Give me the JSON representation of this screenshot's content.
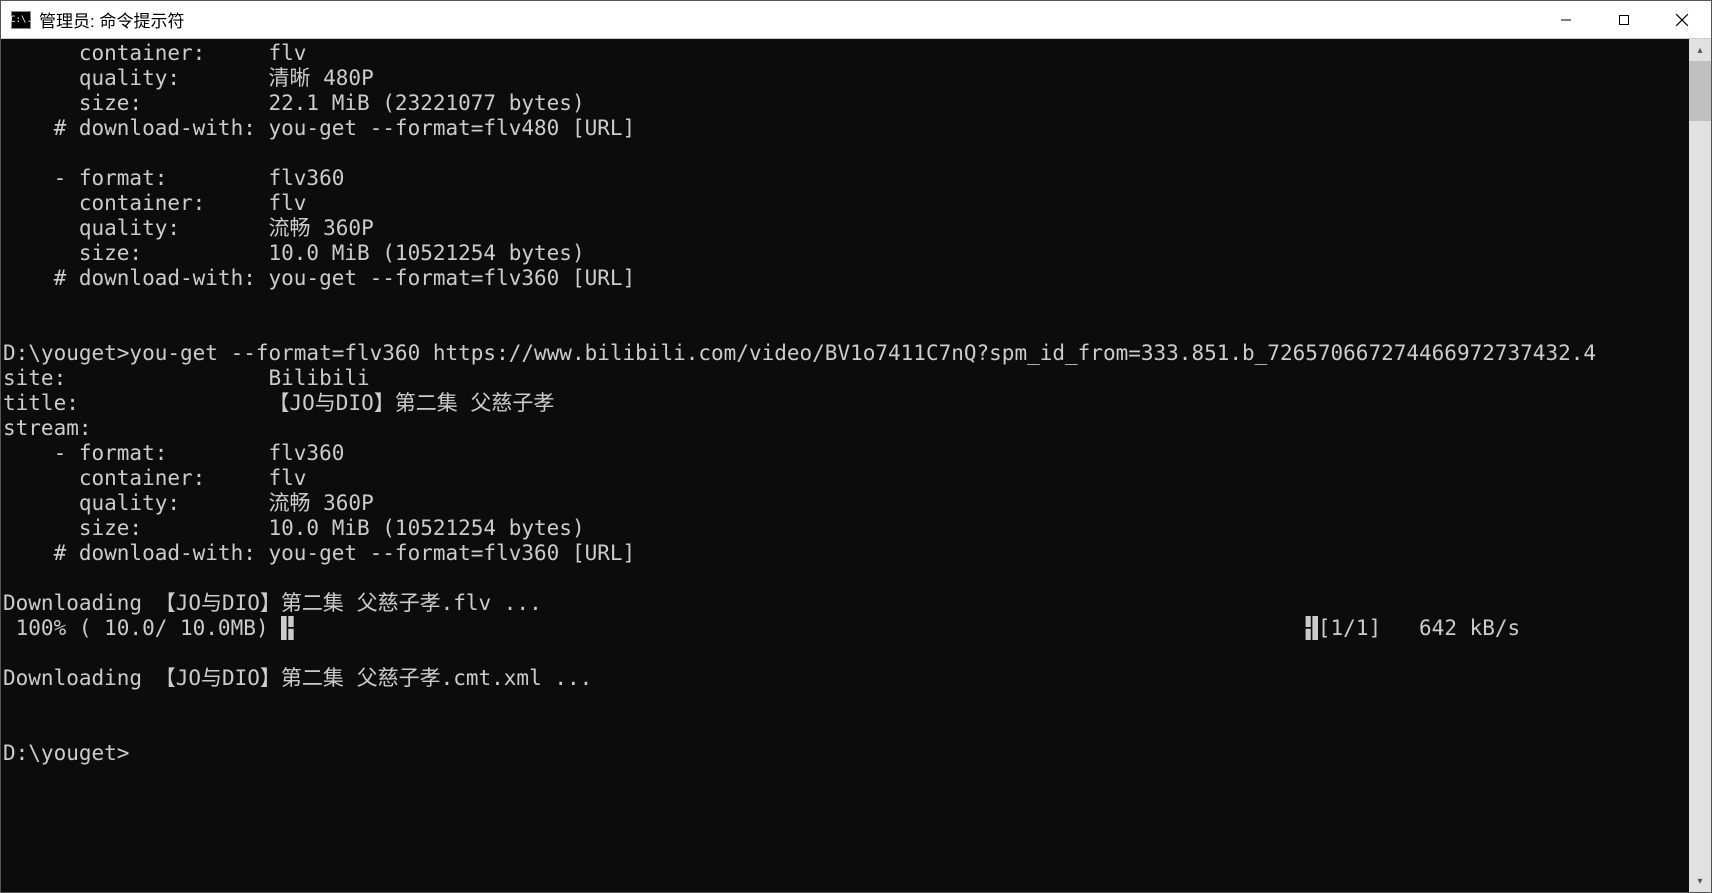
{
  "window": {
    "title": "管理员: 命令提示符",
    "icon_text": "C:\\."
  },
  "terminal": {
    "lines": {
      "l01": "      container:     flv",
      "l02": "      quality:       清晰 480P",
      "l03": "      size:          22.1 MiB (23221077 bytes)",
      "l04": "    # download-with: you-get --format=flv480 [URL]",
      "l05": "",
      "l06": "    - format:        flv360",
      "l07": "      container:     flv",
      "l08": "      quality:       流畅 360P",
      "l09": "      size:          10.0 MiB (10521254 bytes)",
      "l10": "    # download-with: you-get --format=flv360 [URL]",
      "l11": "",
      "l12": "",
      "l13": "D:\\youget>you-get --format=flv360 https://www.bilibili.com/video/BV1o7411C7nQ?spm_id_from=333.851.b_726570667274466972737432.4",
      "l14": "site:                Bilibili",
      "l15": "title:               【JO与DIO】第二集 父慈子孝",
      "l16": "stream:",
      "l17": "    - format:        flv360",
      "l18": "      container:     flv",
      "l19": "      quality:       流畅 360P",
      "l20": "      size:          10.0 MiB (10521254 bytes)",
      "l21": "    # download-with: you-get --format=flv360 [URL]",
      "l22": "",
      "l23": "Downloading 【JO与DIO】第二集 父慈子孝.flv ...",
      "l24_a": " 100% ( 10.0/ 10.0MB) ",
      "l24_b": "├████████████████████████████████████████████████████████████████████████████████┤",
      "l24_c": "[1/1]   642 kB/s",
      "l25": "",
      "l26": "Downloading 【JO与DIO】第二集 父慈子孝.cmt.xml ...",
      "l27": "",
      "l28": "",
      "l29": "D:\\youget>"
    }
  }
}
